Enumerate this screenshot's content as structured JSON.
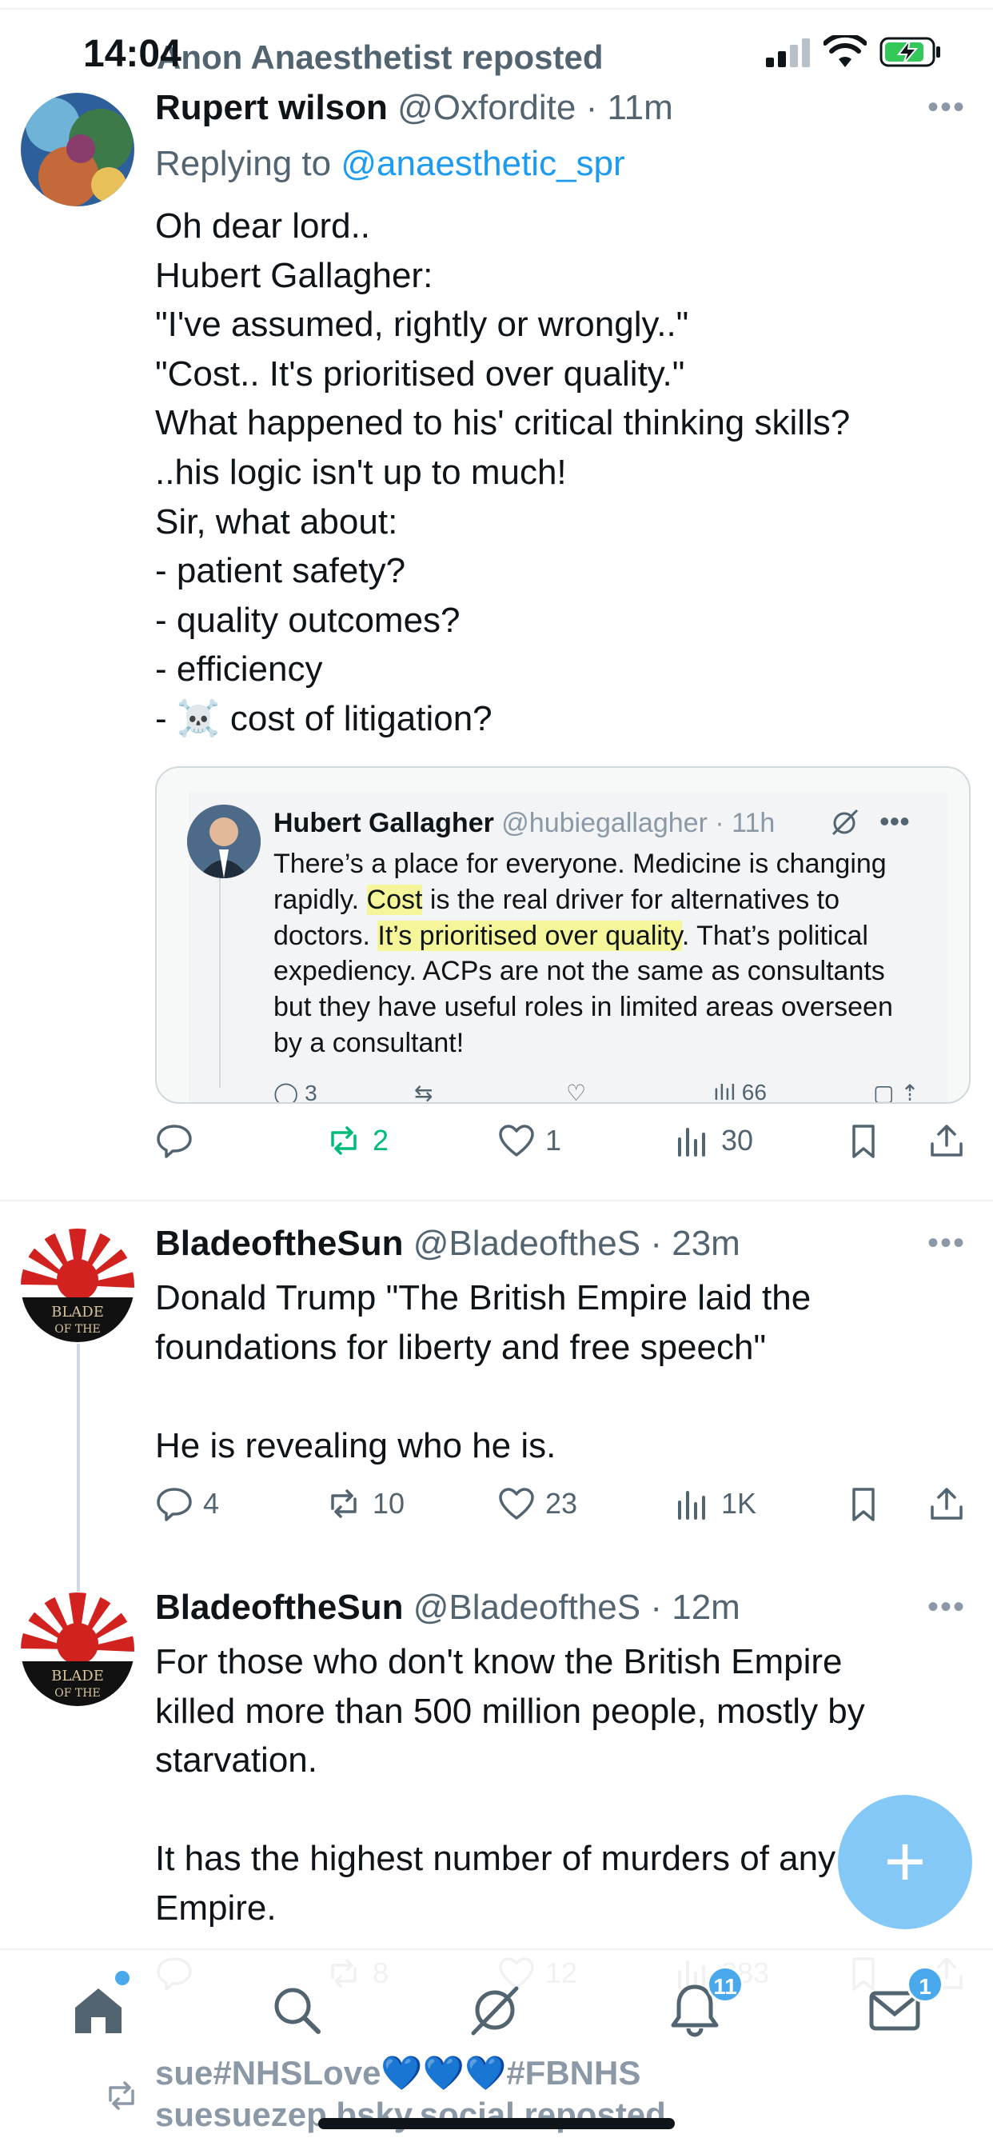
{
  "status": {
    "time": "14:04",
    "repost_header": "Anon Anaesthetist reposted"
  },
  "post1": {
    "name": "Rupert wilson",
    "handle": "@Oxfordite",
    "time": "· 11m",
    "replying_prefix": "Replying to ",
    "replying_handle": "@anaesthetic_spr",
    "lines": [
      "Oh dear lord..",
      "Hubert Gallagher:",
      "\"I've assumed, rightly or wrongly..\"",
      "\"Cost.. It's prioritised over quality.\"",
      "What happened to his' critical thinking skills?",
      "..his logic isn't up to much!",
      "Sir, what about:",
      "- patient safety?",
      "- quality outcomes?",
      "- efficiency",
      "- ☠️ cost of litigation?"
    ],
    "quote": {
      "name": "Hubert Gallagher",
      "handle": "@hubiegallagher · 11h",
      "line1": "There’s a place for everyone. Medicine is changing",
      "line2_a": "rapidly. ",
      "line2_hl": "Cost",
      "line2_b": " is the real driver for alternatives to",
      "line3_a": "doctors.  ",
      "line3_hl": "It’s prioritised over quality",
      "line3_b": ". That’s political",
      "line4": "expediency. ACPs are not the same as consultants",
      "line5": "but they have useful roles in limited areas overseen",
      "line6": "by a consultant!",
      "replies": "3",
      "views": "66"
    },
    "reposts": "2",
    "likes": "1",
    "views": "30"
  },
  "post2": {
    "name": "BladeoftheSun",
    "handle": "@BladeoftheS",
    "time": "· 23m",
    "lines": [
      "Donald Trump \"The British Empire laid the",
      "foundations for liberty and free speech\"",
      "",
      "He is revealing who he is."
    ],
    "replies": "4",
    "reposts": "10",
    "likes": "23",
    "views": "1K"
  },
  "post3": {
    "name": "BladeoftheSun",
    "handle": "@BladeoftheS",
    "time": "· 12m",
    "lines": [
      "For those who don't know the British Empire",
      "killed more than 500 million people, mostly by",
      "starvation.",
      "",
      "It has the highest number of murders of any",
      "Empire."
    ],
    "reposts": "8",
    "likes": "12",
    "views": "383"
  },
  "tabbar": {
    "notifications_badge": "11",
    "messages_badge": "1"
  },
  "peek": {
    "name": "sue#NHSLove💙💙💙#FBNHS",
    "repost": "suesuezep.bsky.social reposted"
  },
  "colors": {
    "accent": "#1d9bf0",
    "repost_green": "#00ba7c",
    "secondary_text": "#536471",
    "highlight": "#f5f59a"
  }
}
